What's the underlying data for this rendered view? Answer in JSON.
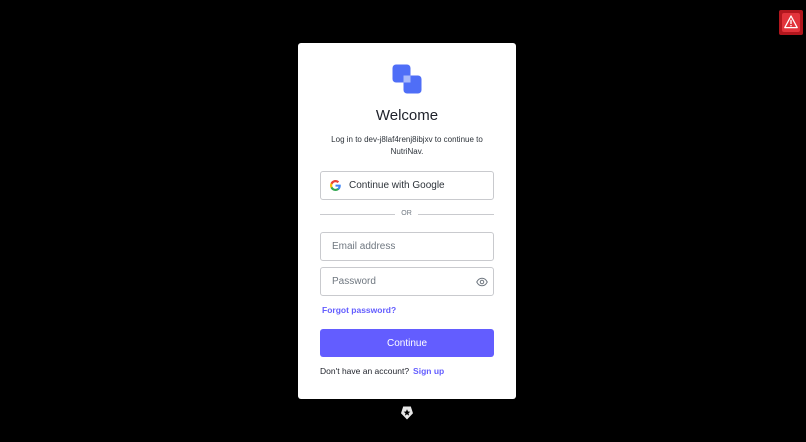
{
  "login": {
    "title": "Welcome",
    "subtitle": "Log in to dev-j8laf4renj8ibjxv to continue to NutriNav.",
    "google_button_label": "Continue with Google",
    "divider_text": "OR",
    "email_placeholder": "Email address",
    "email_value": "",
    "password_placeholder": "Password",
    "password_value": "",
    "forgot_password_label": "Forgot password?",
    "continue_label": "Continue",
    "signup_prompt": "Don't have an account?",
    "signup_link_label": "Sign up"
  },
  "icons": {
    "logo": "brand-logo-icon",
    "google": "google-icon",
    "show_password": "eye-icon",
    "footer_badge": "shield-icon",
    "alert": "warning-icon"
  },
  "colors": {
    "background": "#000000",
    "card": "#ffffff",
    "accent": "#635dff",
    "logo_primary": "#4f6ef7",
    "warning": "#e2333b"
  }
}
